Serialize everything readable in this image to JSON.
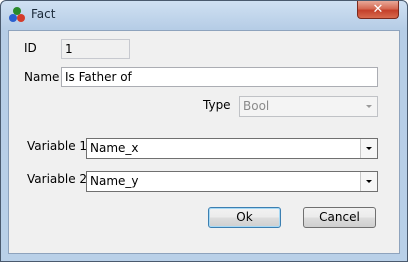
{
  "window": {
    "title": "Fact",
    "close_label": "✕"
  },
  "form": {
    "id": {
      "label": "ID",
      "value": "1"
    },
    "name": {
      "label": "Name",
      "value": "Is Father of"
    },
    "type": {
      "label": "Type",
      "selected": "Bool"
    },
    "variable1": {
      "label": "Variable 1",
      "selected": "Name_x"
    },
    "variable2": {
      "label": "Variable 2",
      "selected": "Name_y"
    }
  },
  "buttons": {
    "ok": "Ok",
    "cancel": "Cancel"
  }
}
